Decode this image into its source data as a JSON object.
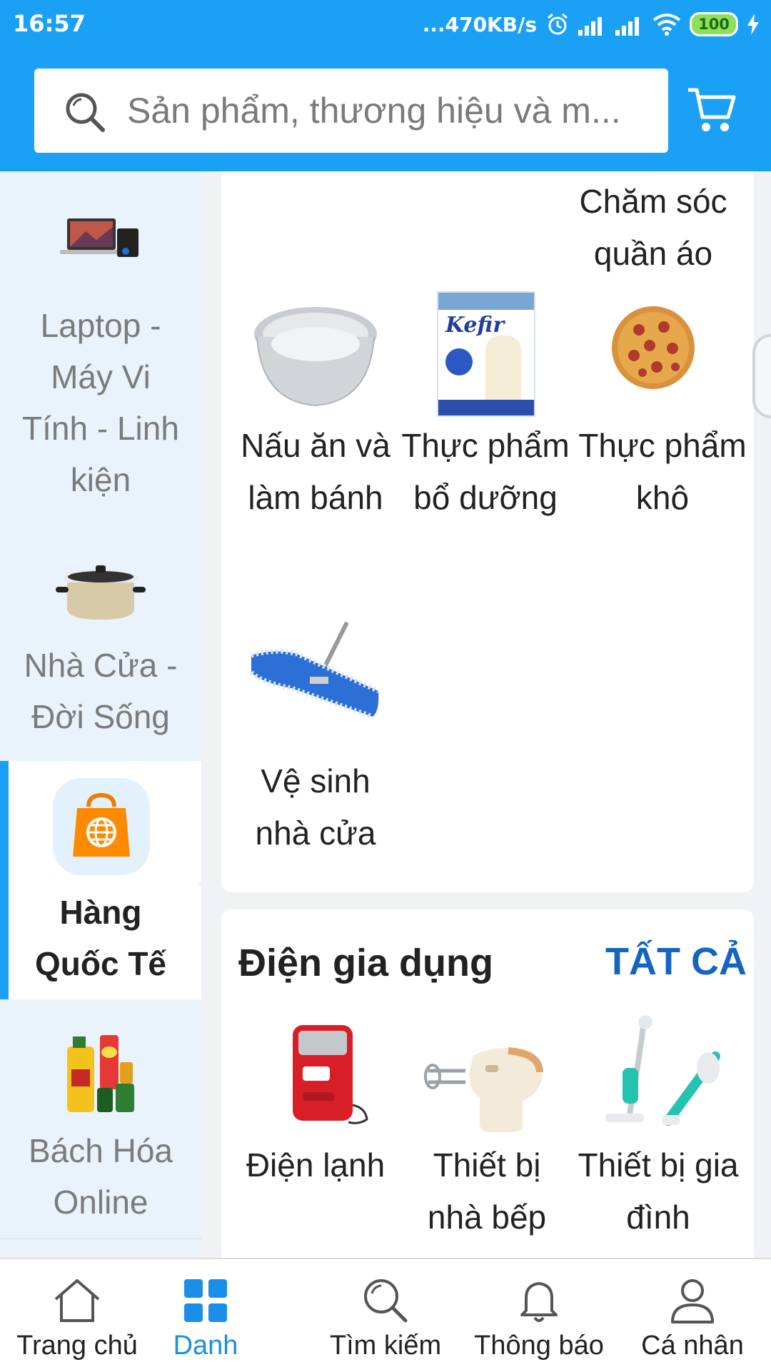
{
  "status_bar": {
    "time": "16:57",
    "network_speed": "...470KB/s",
    "battery": "100"
  },
  "search": {
    "placeholder": "Sản phẩm, thương hiệu và m..."
  },
  "sidebar": {
    "items": [
      {
        "label": "Laptop - Máy Vi Tính - Linh kiện",
        "icon": "laptop-icon"
      },
      {
        "label": "Nhà Cửa - Đời Sống",
        "icon": "cookware-icon"
      },
      {
        "label": "Hàng Quốc Tế",
        "icon": "global-bag-icon",
        "active": true
      },
      {
        "label": "Bách Hóa Online",
        "icon": "grocery-icon"
      }
    ]
  },
  "section1": {
    "top_item": "Chăm sóc quần áo",
    "items": [
      {
        "label": "Nấu ăn và làm bánh",
        "icon": "baking-pan-icon"
      },
      {
        "label": "Thực phẩm bổ dưỡng",
        "icon": "kefir-box-icon",
        "image_text": "Kefir"
      },
      {
        "label": "Thực phẩm khô",
        "icon": "pizza-icon"
      },
      {
        "label": "Vệ sinh nhà cửa",
        "icon": "mop-icon"
      }
    ]
  },
  "section2": {
    "title": "Điện gia dụng",
    "see_all": "TẤT CẢ",
    "items": [
      {
        "label": "Điện lạnh",
        "icon": "mini-fridge-icon"
      },
      {
        "label": "Thiết bị nhà bếp",
        "icon": "hand-mixer-icon"
      },
      {
        "label": "Thiết bị gia đình",
        "icon": "vacuum-cleaner-icon"
      }
    ]
  },
  "bottom_nav": [
    {
      "label": "Trang chủ",
      "icon": "home-icon"
    },
    {
      "label": "Danh",
      "icon": "grid-icon",
      "active": true
    },
    {
      "label": "Tìm kiếm",
      "icon": "search-icon"
    },
    {
      "label": "Thông báo",
      "icon": "bell-icon"
    },
    {
      "label": "Cá nhân",
      "icon": "user-icon"
    }
  ],
  "colors": {
    "primary": "#1aa1f5",
    "link": "#1565c0",
    "sidebar_bg": "#eaf3fb",
    "page_bg": "#f0f2f5"
  }
}
